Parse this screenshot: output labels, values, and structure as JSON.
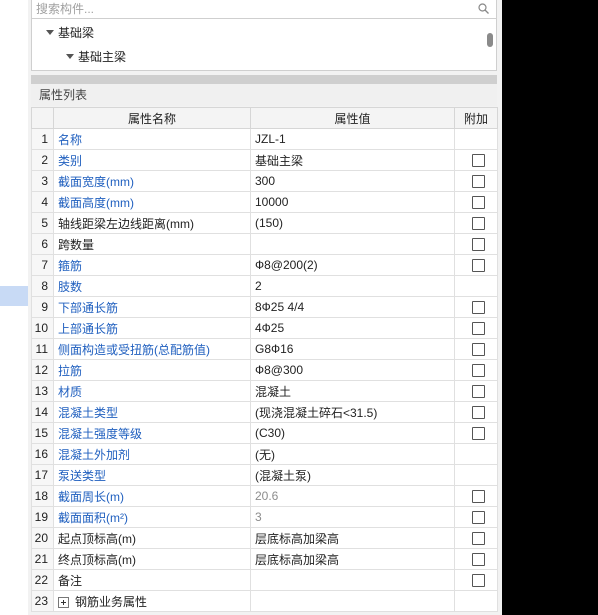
{
  "search": {
    "placeholder": "搜索构件..."
  },
  "tree": {
    "nodes": [
      {
        "label": "基础梁"
      },
      {
        "label": "基础主梁"
      }
    ]
  },
  "properties": {
    "header": "属性列表",
    "columns": [
      "属性名称",
      "属性值",
      "附加"
    ],
    "rows": [
      {
        "idx": "1",
        "name": "名称",
        "value": "JZL-1",
        "blue": true,
        "checkbox": false
      },
      {
        "idx": "2",
        "name": "类别",
        "value": "基础主梁",
        "blue": true,
        "checkbox": true
      },
      {
        "idx": "3",
        "name": "截面宽度(mm)",
        "value": "300",
        "blue": true,
        "checkbox": true
      },
      {
        "idx": "4",
        "name": "截面高度(mm)",
        "value": "10000",
        "blue": true,
        "checkbox": true
      },
      {
        "idx": "5",
        "name": "轴线距梁左边线距离(mm)",
        "value": "(150)",
        "blue": false,
        "checkbox": true
      },
      {
        "idx": "6",
        "name": "跨数量",
        "value": "",
        "blue": false,
        "checkbox": true
      },
      {
        "idx": "7",
        "name": "箍筋",
        "value": "Ф8@200(2)",
        "blue": true,
        "checkbox": true
      },
      {
        "idx": "8",
        "name": "肢数",
        "value": "2",
        "blue": true,
        "checkbox": false
      },
      {
        "idx": "9",
        "name": "下部通长筋",
        "value": "8Ф25 4/4",
        "blue": true,
        "checkbox": true
      },
      {
        "idx": "10",
        "name": "上部通长筋",
        "value": "4Ф25",
        "blue": true,
        "checkbox": true
      },
      {
        "idx": "11",
        "name": "侧面构造或受扭筋(总配筋值)",
        "value": "G8Ф16",
        "blue": true,
        "checkbox": true
      },
      {
        "idx": "12",
        "name": "拉筋",
        "value": "Ф8@300",
        "blue": true,
        "checkbox": true
      },
      {
        "idx": "13",
        "name": "材质",
        "value": "混凝土",
        "blue": true,
        "checkbox": true
      },
      {
        "idx": "14",
        "name": "混凝土类型",
        "value": "(现浇混凝土碎石<31.5)",
        "blue": true,
        "checkbox": true
      },
      {
        "idx": "15",
        "name": "混凝土强度等级",
        "value": "(C30)",
        "blue": true,
        "checkbox": true
      },
      {
        "idx": "16",
        "name": "混凝土外加剂",
        "value": "(无)",
        "blue": true,
        "checkbox": false
      },
      {
        "idx": "17",
        "name": "泵送类型",
        "value": "(混凝土泵)",
        "blue": true,
        "checkbox": false
      },
      {
        "idx": "18",
        "name": "截面周长(m)",
        "value": "20.6",
        "blue": true,
        "gray": true,
        "checkbox": true
      },
      {
        "idx": "19",
        "name": "截面面积(m²)",
        "value": "3",
        "blue": true,
        "gray": true,
        "checkbox": true
      },
      {
        "idx": "20",
        "name": "起点顶标高(m)",
        "value": "层底标高加梁高",
        "blue": false,
        "checkbox": true
      },
      {
        "idx": "21",
        "name": "终点顶标高(m)",
        "value": "层底标高加梁高",
        "blue": false,
        "checkbox": true
      },
      {
        "idx": "22",
        "name": "备注",
        "value": "",
        "blue": false,
        "checkbox": true
      },
      {
        "idx": "23",
        "name": "钢筋业务属性",
        "value": "",
        "blue": false,
        "checkbox": false,
        "expandable": true
      }
    ]
  },
  "colors": {
    "blue_text": "#1f5fbf",
    "selection": "#c8daf5"
  },
  "icons": {
    "search": "search-icon",
    "tree_expand": "caret-down-icon",
    "group_expand": "plus-box-icon"
  }
}
